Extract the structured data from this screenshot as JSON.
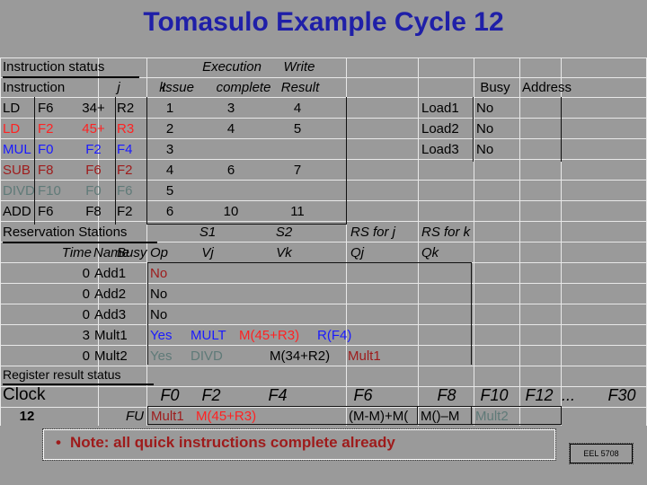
{
  "slide": {
    "title": "Tomasulo Example Cycle 12",
    "title_color": "#1f1fa8",
    "background_color": "#9a9a9a"
  },
  "colors": {
    "black": "#000000",
    "red": "#ff2222",
    "blue": "#1a1aff",
    "dark_red": "#9e1b1b",
    "teal_gray": "#5f7a78",
    "note_red": "#9e1b1b"
  },
  "instruction_status": {
    "section_label": "Instruction status",
    "group_headers": {
      "execution": "Execution",
      "write": "Write"
    },
    "headers": {
      "instruction": "Instruction",
      "j": "j",
      "k": "k",
      "issue": "Issue",
      "exec_complete": "complete",
      "write_result": "Result"
    },
    "rows": [
      {
        "op": "LD",
        "j": "F6",
        "k": "34+",
        "k2": "R2",
        "issue": "1",
        "complete": "3",
        "write": "4",
        "color": "black"
      },
      {
        "op": "LD",
        "j": "F2",
        "k": "45+",
        "k2": "R3",
        "issue": "2",
        "complete": "4",
        "write": "5",
        "color": "red"
      },
      {
        "op": "MUL",
        "j": "F0",
        "k": "F2",
        "k2": "F4",
        "issue": "3",
        "complete": "",
        "write": "",
        "color": "blue"
      },
      {
        "op": "SUB",
        "j": "F8",
        "k": "F6",
        "k2": "F2",
        "issue": "4",
        "complete": "6",
        "write": "7",
        "color": "dark_red"
      },
      {
        "op": "DIVD",
        "j": "F10",
        "k": "F0",
        "k2": "F6",
        "issue": "5",
        "complete": "",
        "write": "",
        "color": "teal_gray"
      },
      {
        "op": "ADD",
        "j": "F6",
        "k": "F8",
        "k2": "F2",
        "issue": "6",
        "complete": "10",
        "write": "11",
        "color": "black"
      }
    ]
  },
  "load_buffers": {
    "headers": {
      "busy": "Busy",
      "address": "Address"
    },
    "rows": [
      {
        "name": "Load1",
        "busy": "No",
        "address": ""
      },
      {
        "name": "Load2",
        "busy": "No",
        "address": ""
      },
      {
        "name": "Load3",
        "busy": "No",
        "address": ""
      }
    ]
  },
  "reservation_stations": {
    "section_label": "Reservation Stations",
    "group_headers": {
      "s1": "S1",
      "s2": "S2",
      "rs_for_j": "RS for j",
      "rs_for_k": "RS for k"
    },
    "headers": {
      "time": "Time",
      "name": "Name",
      "busy": "Busy",
      "op": "Op",
      "vj": "Vj",
      "vk": "Vk",
      "qj": "Qj",
      "qk": "Qk"
    },
    "rows": [
      {
        "time": "0",
        "name": "Add1",
        "busy": "No",
        "op": "",
        "vj": "",
        "vk": "",
        "qj": "",
        "qk": "",
        "color": "black",
        "busy_color": "dark_red"
      },
      {
        "time": "0",
        "name": "Add2",
        "busy": "No",
        "op": "",
        "vj": "",
        "vk": "",
        "qj": "",
        "qk": "",
        "color": "black",
        "busy_color": "black"
      },
      {
        "time": "0",
        "name": "Add3",
        "busy": "No",
        "op": "",
        "vj": "",
        "vk": "",
        "qj": "",
        "qk": "",
        "color": "black",
        "busy_color": "black"
      },
      {
        "time": "3",
        "name": "Mult1",
        "busy": "Yes",
        "op": "MULT",
        "vj": "M(45+R3)",
        "vk": "R(F4)",
        "qj": "",
        "qk": "",
        "color": "black",
        "busy_color": "blue"
      },
      {
        "time": "0",
        "name": "Mult2",
        "busy": "Yes",
        "op": "DIVD",
        "vj": "",
        "vk": "M(34+R2)",
        "qj": "Mult1",
        "qk": "",
        "color": "black",
        "busy_color": "teal_gray"
      }
    ]
  },
  "register_result_status": {
    "section_label": "Register result status",
    "clock_label": "Clock",
    "clock_value": "12",
    "fu_label": "FU",
    "registers": [
      "F0",
      "F2",
      "F4",
      "F6",
      "F8",
      "F10",
      "F12",
      "...",
      "F30"
    ],
    "values": [
      {
        "reg": "F0",
        "value": "Mult1",
        "color": "dark_red"
      },
      {
        "reg": "F2",
        "value": "M(45+R3)",
        "color": "red"
      },
      {
        "reg": "F4",
        "value": "",
        "color": "black"
      },
      {
        "reg": "F6",
        "value": "(M-M)+M(",
        "color": "black"
      },
      {
        "reg": "F8",
        "value": "M()–M",
        "color": "black"
      },
      {
        "reg": "F10",
        "value": "Mult2",
        "color": "teal_gray"
      },
      {
        "reg": "F12",
        "value": "",
        "color": "black"
      },
      {
        "reg": "...",
        "value": "",
        "color": "black"
      },
      {
        "reg": "F30",
        "value": "",
        "color": "black"
      }
    ]
  },
  "note": {
    "bullet": "•",
    "text": "Note: all quick instructions complete already"
  },
  "footer_badge": {
    "label": "EEL 5708"
  }
}
